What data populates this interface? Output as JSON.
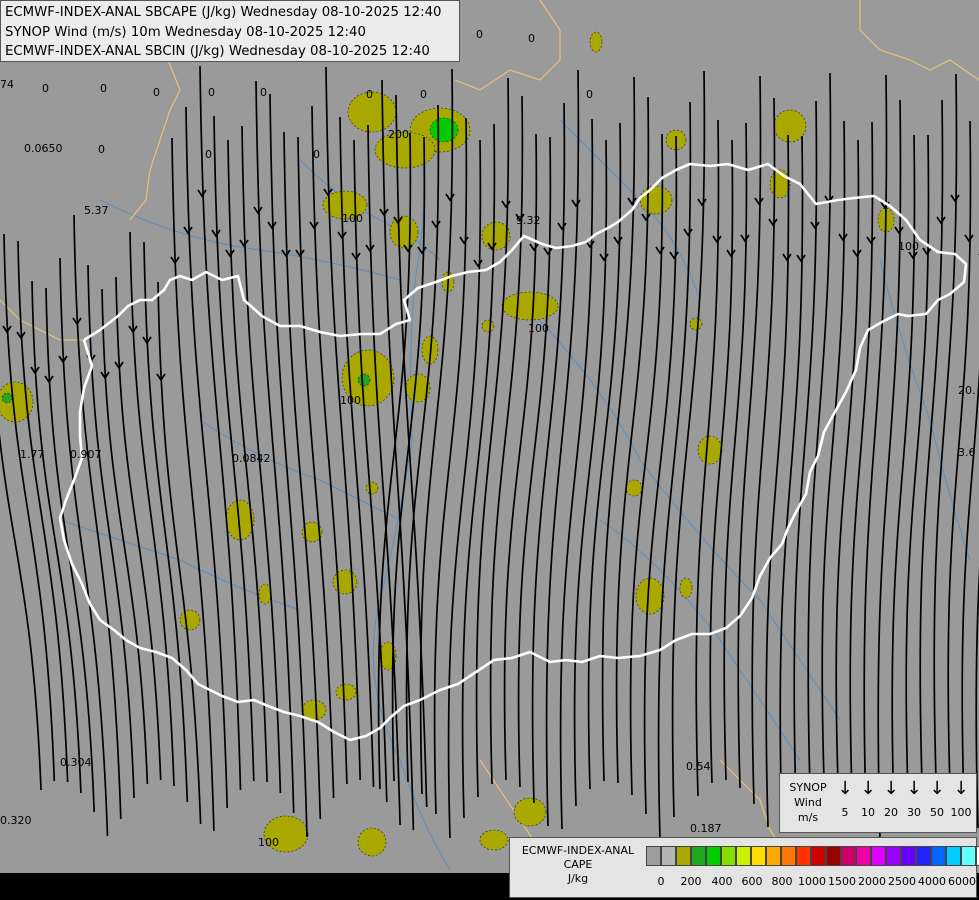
{
  "title": {
    "lines": [
      "ECMWF-INDEX-ANAL SBCAPE (J/kg) Wednesday 08-10-2025 12:40",
      "SYNOP Wind (m/s) 10m Wednesday 08-10-2025 12:40",
      "ECMWF-INDEX-ANAL SBCIN (J/kg) Wednesday 08-10-2025 12:40"
    ]
  },
  "colors": {
    "background": "#9a9a9a",
    "border": "#ffffff",
    "coastline": "#e8c27a",
    "river": "#4f8cc6",
    "cape_low": "#a8a800",
    "cape_mid": "#22a622",
    "cape_high": "#00cc00",
    "streamline": "#000000"
  },
  "cin_values": [
    "0",
    "0",
    "0",
    "0",
    "0",
    "0",
    "0",
    "0",
    "0",
    "0",
    "0",
    "0",
    "0",
    "0.0650",
    "5.37",
    "9.32",
    "1.77",
    "0.907",
    "0.0842",
    "0.304",
    "0.320",
    "0.187",
    "0.54",
    "20.",
    "3.6",
    "74",
    "200",
    "100",
    "100",
    "100",
    "100",
    "100"
  ],
  "synop_legend": {
    "title_lines": [
      "SYNOP",
      "Wind",
      "m/s"
    ],
    "speeds": [
      "5",
      "10",
      "20",
      "30",
      "50",
      "100"
    ],
    "arrow_icon": "down-arrow-icon"
  },
  "cape_legend": {
    "title_lines": [
      "ECMWF-INDEX-ANAL",
      "CAPE",
      "J/kg"
    ],
    "swatches": [
      "#9e9e9e",
      "#b4b4b4",
      "#a8a800",
      "#22a622",
      "#00cc00",
      "#88dd00",
      "#ccee00",
      "#ffdd00",
      "#ffaa00",
      "#ff7700",
      "#ff3300",
      "#cc0000",
      "#990000",
      "#cc0066",
      "#ee00aa",
      "#dd00ff",
      "#9900ff",
      "#6600ff",
      "#2222ff",
      "#0066ff",
      "#00ccff",
      "#66ffff",
      "#ffffff"
    ],
    "ticks": [
      "0",
      "200",
      "400",
      "600",
      "800",
      "1000",
      "1500",
      "2000",
      "2500",
      "4000",
      "6000"
    ]
  }
}
